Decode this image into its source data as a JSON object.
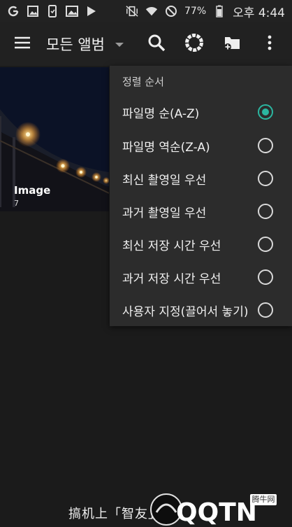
{
  "status_bar": {
    "battery_percent": "77%",
    "time": "오후 4:44",
    "icons_left": [
      "google-g-icon",
      "image-notification-icon",
      "cast-icon",
      "photo-icon",
      "play-store-icon"
    ],
    "icons_right": [
      "vibrate-mute-icon",
      "wifi-icon",
      "do-not-disturb-icon",
      "battery-icon"
    ]
  },
  "app_bar": {
    "title": "모든 앨범",
    "icons": [
      "menu-icon",
      "dropdown-arrow-icon",
      "search-icon",
      "color-ring-icon",
      "add-folder-icon",
      "more-vert-icon"
    ]
  },
  "gallery": {
    "albums": [
      {
        "name": "Image",
        "count": "7"
      }
    ]
  },
  "sort_menu": {
    "title": "정렬 순서",
    "options": [
      {
        "label": "파일명 순(A-Z)",
        "selected": true
      },
      {
        "label": "파일명 역순(Z-A)",
        "selected": false
      },
      {
        "label": "최신 촬영일 우선",
        "selected": false
      },
      {
        "label": "과거 촬영일 우선",
        "selected": false
      },
      {
        "label": "최신 저장 시간 우선",
        "selected": false
      },
      {
        "label": "과거 저장 시간 우선",
        "selected": false
      },
      {
        "label": "사용자 지정(끌어서 놓기)",
        "selected": false
      }
    ],
    "accent_color": "#2bb6a0"
  },
  "watermark": {
    "text": "搞机上「智友」提",
    "logo_text": "QQTN",
    "badge_text": "腾牛网"
  }
}
